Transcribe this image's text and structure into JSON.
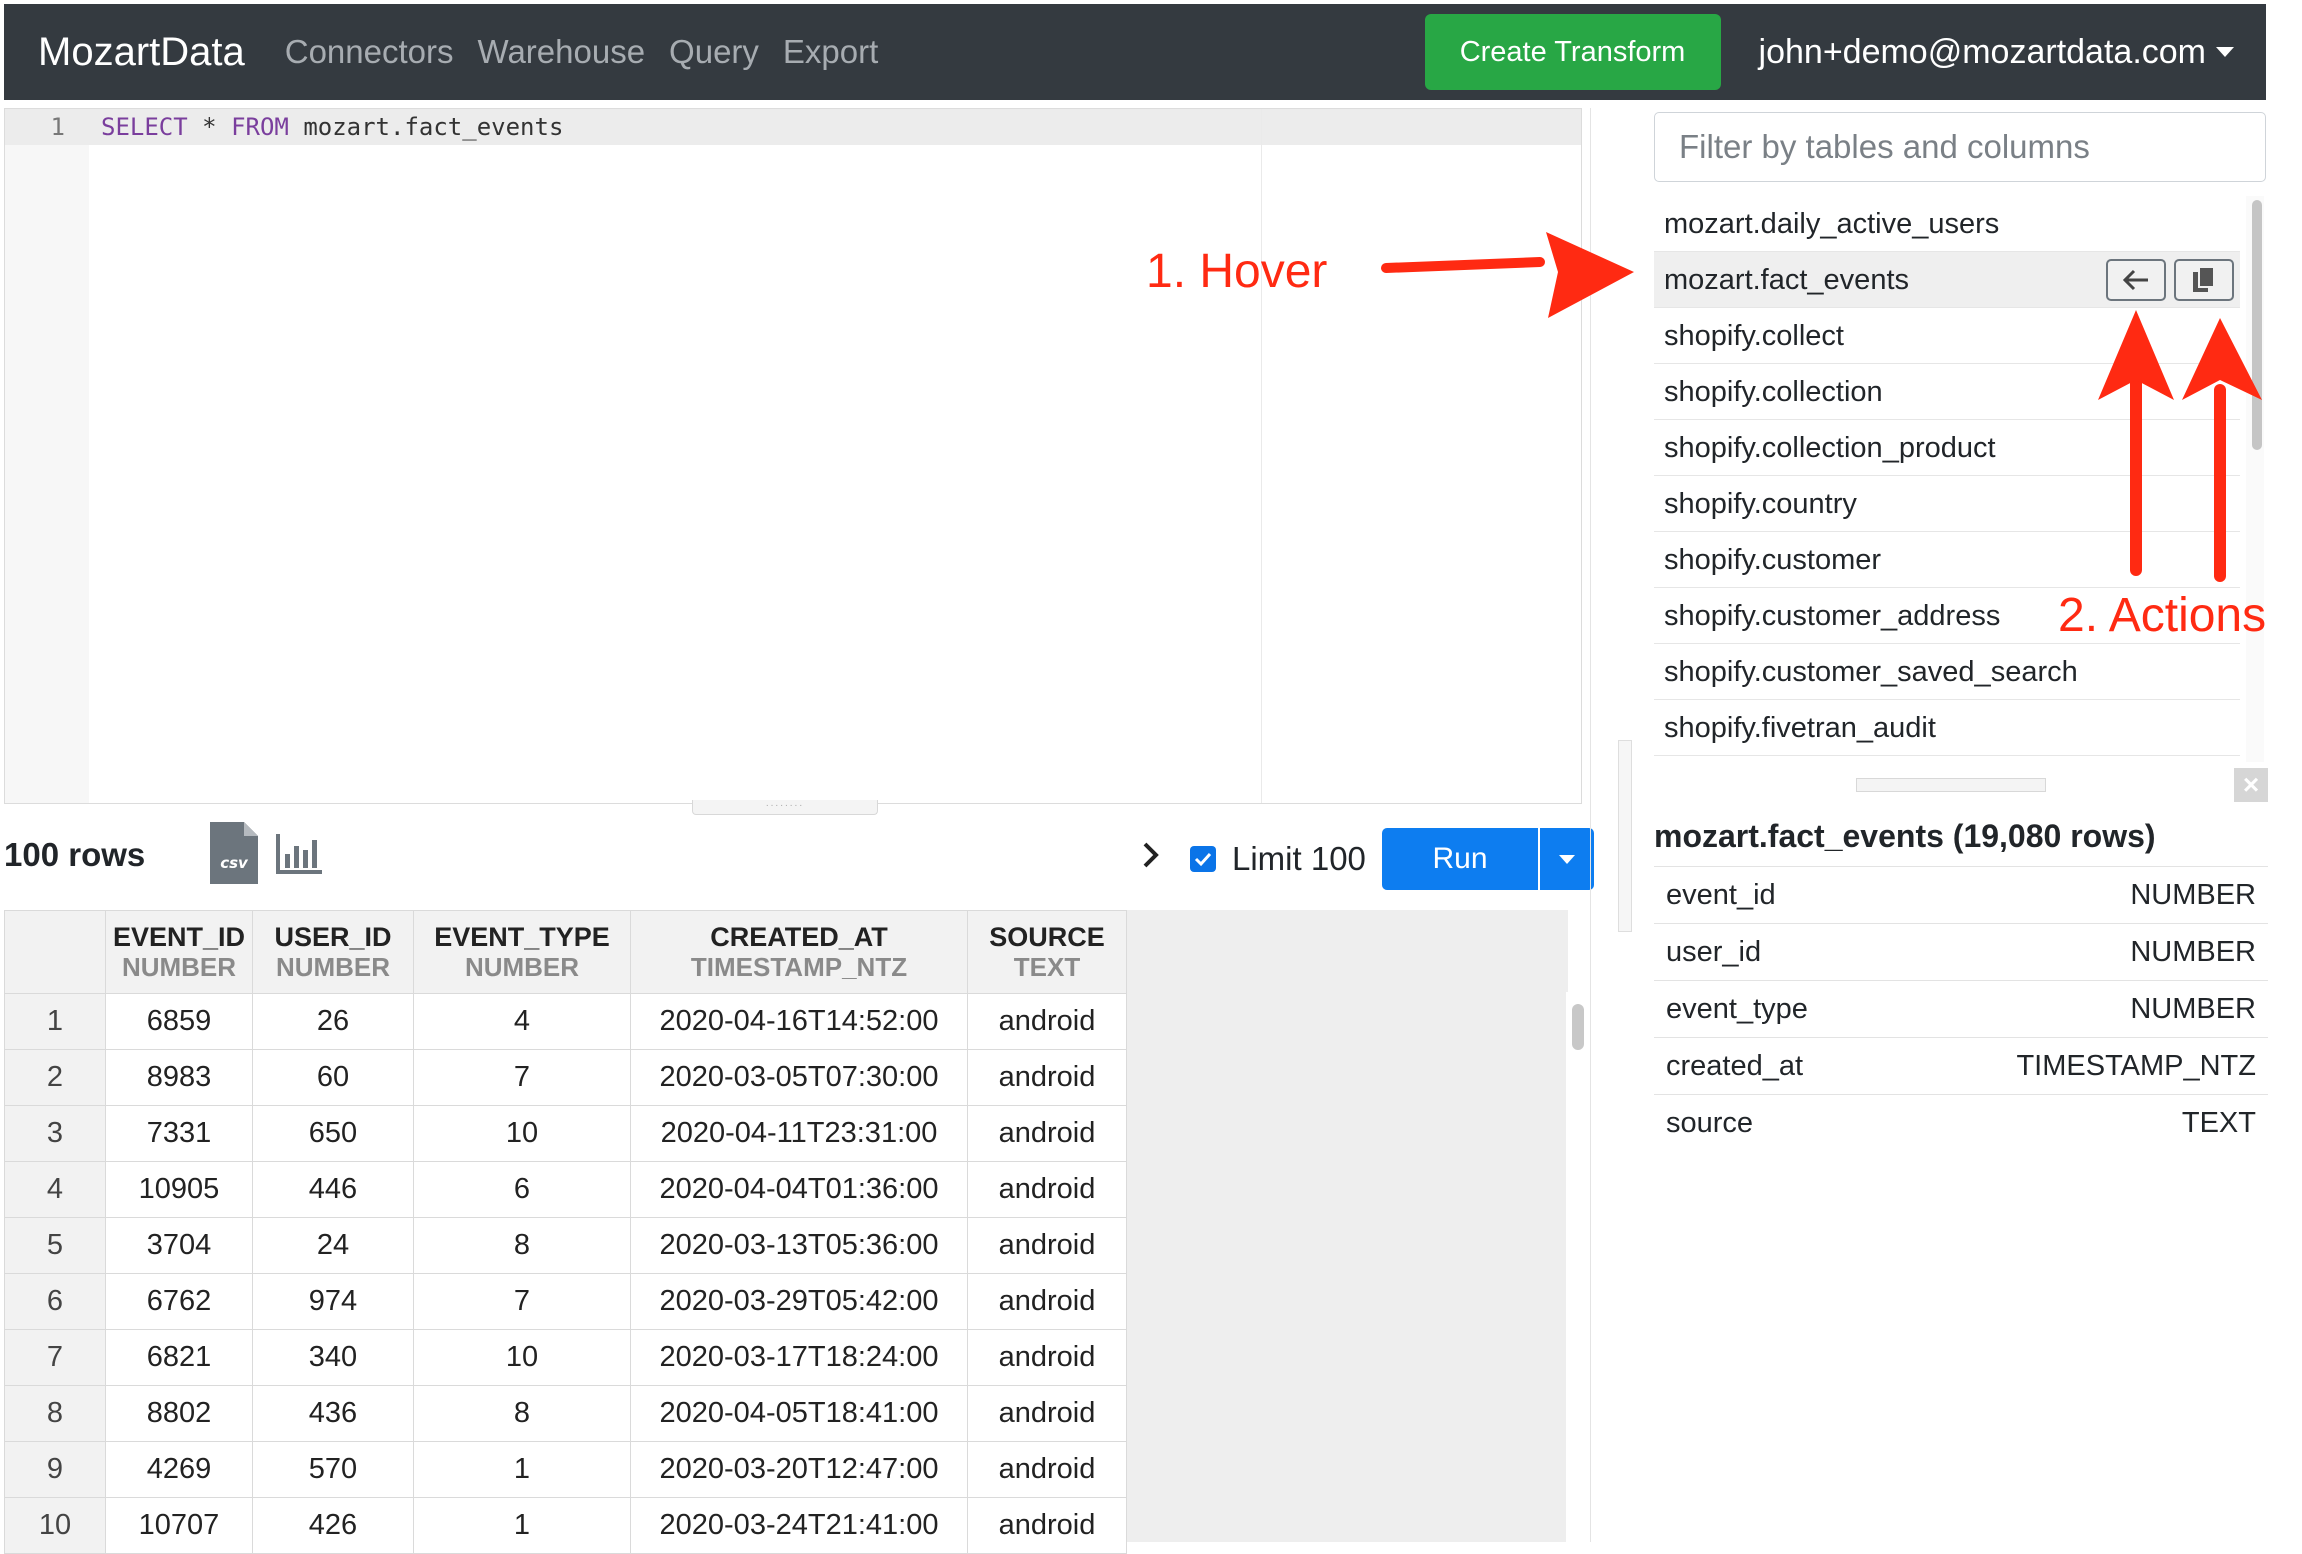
{
  "navbar": {
    "brand": "MozartData",
    "links": [
      "Connectors",
      "Warehouse",
      "Query",
      "Export"
    ],
    "create_button": "Create Transform",
    "user_email": "john+demo@mozartdata.com"
  },
  "editor": {
    "line_number": "1",
    "query_keyword_1": "SELECT",
    "query_star": "*",
    "query_keyword_2": "FROM",
    "query_table": "mozart.fact_events"
  },
  "results": {
    "row_count": "100 rows",
    "csv_icon_text": "csv",
    "limit_checked": true,
    "limit_label": "Limit 100",
    "run_label": "Run",
    "columns": [
      {
        "name": "EVENT_ID",
        "type": "NUMBER"
      },
      {
        "name": "USER_ID",
        "type": "NUMBER"
      },
      {
        "name": "EVENT_TYPE",
        "type": "NUMBER"
      },
      {
        "name": "CREATED_AT",
        "type": "TIMESTAMP_NTZ"
      },
      {
        "name": "SOURCE",
        "type": "TEXT"
      }
    ],
    "rows": [
      [
        "1",
        "6859",
        "26",
        "4",
        "2020-04-16T14:52:00",
        "android"
      ],
      [
        "2",
        "8983",
        "60",
        "7",
        "2020-03-05T07:30:00",
        "android"
      ],
      [
        "3",
        "7331",
        "650",
        "10",
        "2020-04-11T23:31:00",
        "android"
      ],
      [
        "4",
        "10905",
        "446",
        "6",
        "2020-04-04T01:36:00",
        "android"
      ],
      [
        "5",
        "3704",
        "24",
        "8",
        "2020-03-13T05:36:00",
        "android"
      ],
      [
        "6",
        "6762",
        "974",
        "7",
        "2020-03-29T05:42:00",
        "android"
      ],
      [
        "7",
        "6821",
        "340",
        "10",
        "2020-03-17T18:24:00",
        "android"
      ],
      [
        "8",
        "8802",
        "436",
        "8",
        "2020-04-05T18:41:00",
        "android"
      ],
      [
        "9",
        "4269",
        "570",
        "1",
        "2020-03-20T12:47:00",
        "android"
      ],
      [
        "10",
        "10707",
        "426",
        "1",
        "2020-03-24T21:41:00",
        "android"
      ]
    ]
  },
  "schema": {
    "filter_placeholder": "Filter by tables and columns",
    "tables": [
      "mozart.daily_active_users",
      "mozart.fact_events",
      "shopify.collect",
      "shopify.collection",
      "shopify.collection_product",
      "shopify.country",
      "shopify.customer",
      "shopify.customer_address",
      "shopify.customer_saved_search",
      "shopify.fivetran_audit"
    ],
    "hovered_table": "mozart.fact_events",
    "details_title": "mozart.fact_events (19,080 rows)",
    "details_columns": [
      {
        "name": "event_id",
        "type": "NUMBER"
      },
      {
        "name": "user_id",
        "type": "NUMBER"
      },
      {
        "name": "event_type",
        "type": "NUMBER"
      },
      {
        "name": "created_at",
        "type": "TIMESTAMP_NTZ"
      },
      {
        "name": "source",
        "type": "TEXT"
      }
    ]
  },
  "annotations": {
    "hover_label": "1. Hover",
    "actions_label": "2. Actions",
    "color": "#ff2a12"
  },
  "icons": {
    "insert": "arrow-left-icon",
    "copy": "copy-icon",
    "csv": "csv-file-icon",
    "chart": "bar-chart-icon",
    "expand": "chevron-right-icon",
    "close": "close-icon"
  }
}
